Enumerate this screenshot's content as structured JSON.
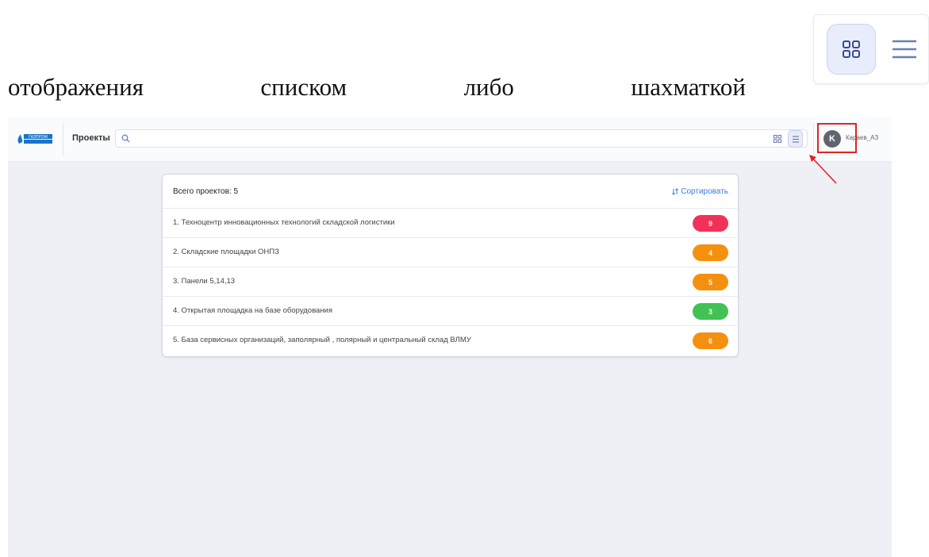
{
  "caption": {
    "words": [
      "отображения",
      "списком",
      "либо",
      "шахматкой"
    ]
  },
  "topbar": {
    "logo_text": "ГАЗПРОМ",
    "projects_label": "Проекты",
    "search_placeholder": "",
    "user_initial": "K",
    "username": "Караев_АЗ"
  },
  "card": {
    "title": "Всего проектов: 5",
    "sort_label": "Сортировать",
    "projects": [
      {
        "label": "1. Техноцентр инновационных технологий складской логистики",
        "count": "9",
        "color": "#f2315a"
      },
      {
        "label": "2. Складские площадки ОНПЗ",
        "count": "4",
        "color": "#f5900f"
      },
      {
        "label": "3. Панели 5,14,13",
        "count": "5",
        "color": "#f5900f"
      },
      {
        "label": "4. Открытая площадка на базе оборудования",
        "count": "3",
        "color": "#41c253"
      },
      {
        "label": "5. База сервисных организаций, заполярный , полярный и центральный склад ВЛМУ",
        "count": "6",
        "color": "#f5900f"
      }
    ]
  },
  "colors": {
    "accent": "#3d7be0",
    "highlight": "#e02424"
  }
}
